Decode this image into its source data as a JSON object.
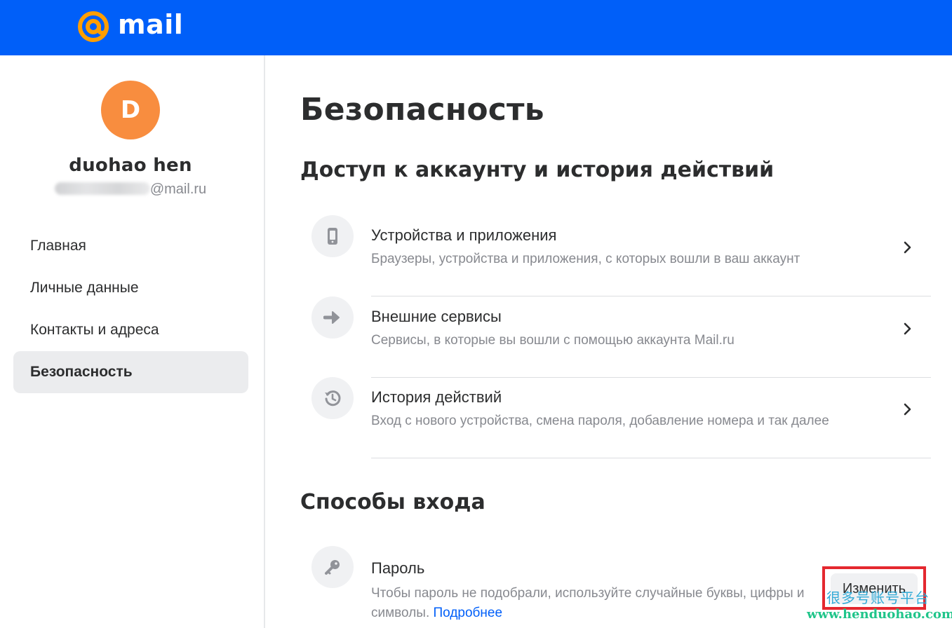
{
  "header": {
    "brand": "mail",
    "colors": {
      "bar": "#005ff9",
      "logo_at": "#ff9e00"
    }
  },
  "sidebar": {
    "avatar_initial": "D",
    "avatar_color": "#f88d3f",
    "user_name": "duohao hen",
    "user_email_visible": "@mail.ru",
    "items": [
      {
        "label": "Главная",
        "active": false
      },
      {
        "label": "Личные данные",
        "active": false
      },
      {
        "label": "Контакты и адреса",
        "active": false
      },
      {
        "label": "Безопасность",
        "active": true
      }
    ]
  },
  "main": {
    "title": "Безопасность",
    "access_section": {
      "title": "Доступ к аккаунту и история действий",
      "rows": [
        {
          "icon": "phone-icon",
          "title": "Устройства и приложения",
          "subtitle": "Браузеры, устройства и приложения, с которых вошли в ваш аккаунт"
        },
        {
          "icon": "arrow-right-icon",
          "title": "Внешние сервисы",
          "subtitle": "Сервисы, в которые вы вошли с помощью аккаунта Mail.ru"
        },
        {
          "icon": "history-icon",
          "title": "История действий",
          "subtitle": "Вход с нового устройства, смена пароля, добавление номера и так далее"
        }
      ]
    },
    "login_section": {
      "title": "Способы входа",
      "password": {
        "icon": "key-icon",
        "title": "Пароль",
        "subtitle": "Чтобы пароль не подобрали, используйте случайные буквы, цифры и символы.",
        "link": "Подробнее",
        "button": "Изменить"
      }
    }
  },
  "watermark": {
    "line1": "很多号账号平台",
    "line2": "www.henduohao.com"
  }
}
